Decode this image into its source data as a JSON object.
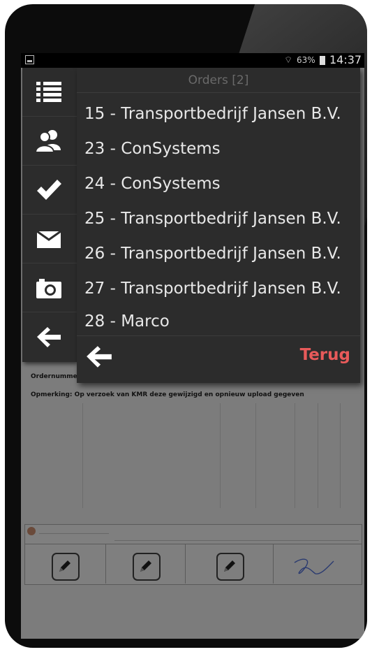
{
  "statusbar": {
    "battery_pct": "63%",
    "time": "14:37"
  },
  "menu": {
    "icons": [
      "list-icon",
      "contacts-icon",
      "checkmark-icon",
      "mail-icon",
      "camera-icon",
      "back-arrow-icon"
    ]
  },
  "orders": {
    "title": "Orders [2]",
    "items": [
      {
        "label": "15 - Transportbedrijf Jansen B.V."
      },
      {
        "label": "23 - ConSystems"
      },
      {
        "label": "24 - ConSystems"
      },
      {
        "label": "25 - Transportbedrijf Jansen B.V."
      },
      {
        "label": "26 - Transportbedrijf Jansen B.V."
      },
      {
        "label": "27 - Transportbedrijf Jansen B.V."
      },
      {
        "label": "28 - Marco"
      }
    ],
    "back_label": "Terug",
    "accent_color": "#e85a5a"
  },
  "document": {
    "order_label": "Ordernummer:",
    "remark": "Opmerking: Op verzoek van KMR deze gewijzigd en opnieuw upload gegeven"
  }
}
